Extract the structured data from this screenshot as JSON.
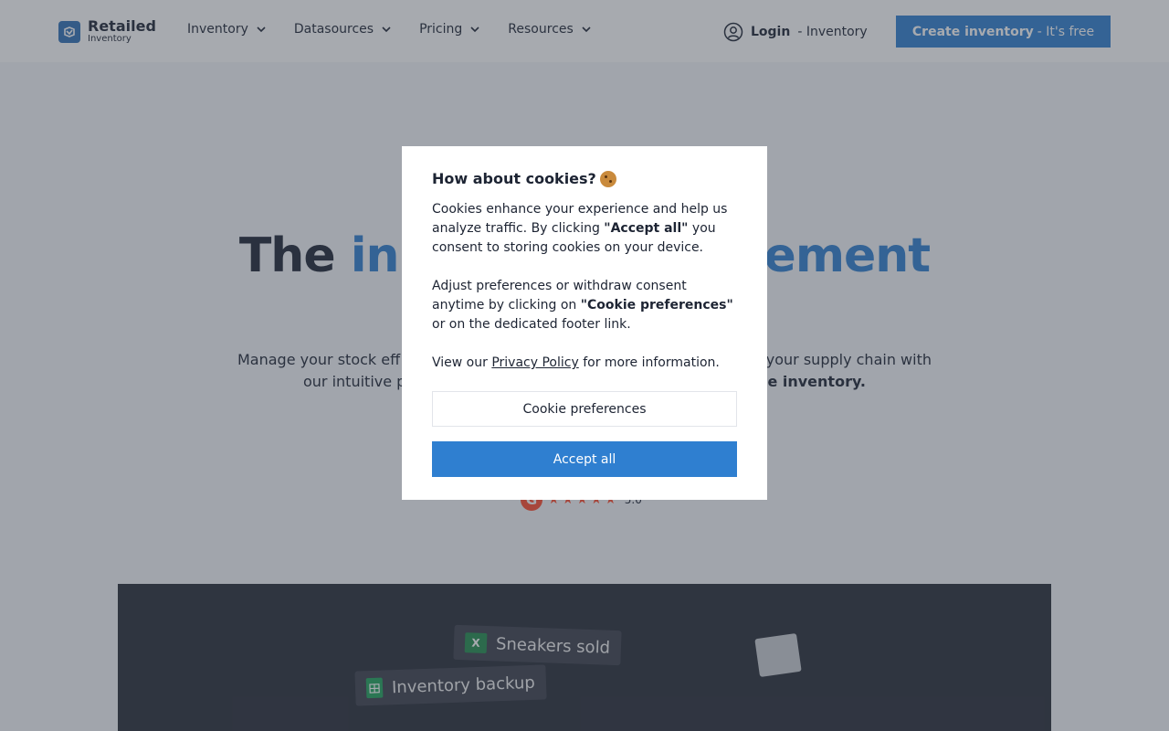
{
  "brand": {
    "name": "Retailed",
    "sub": "Inventory"
  },
  "nav": {
    "items": [
      {
        "label": "Inventory"
      },
      {
        "label": "Datasources"
      },
      {
        "label": "Pricing"
      },
      {
        "label": "Resources"
      }
    ],
    "login_bold": "Login",
    "login_rest": "- Inventory",
    "cta_bold": "Create inventory",
    "cta_rest": "- It's free"
  },
  "hero": {
    "title_start": "The",
    "title_accent_left": "in",
    "title_accent_right": "ement",
    "desc_left": "Manage your stock eff",
    "desc_right": "your supply chain with",
    "desc_left2": "our intuitive p",
    "desc_right2_bold": "he inventory.",
    "rating_value": "5.0"
  },
  "demo": {
    "chip_sneakers": "Sneakers sold",
    "chip_backup": "Inventory backup"
  },
  "cookie_modal": {
    "title": "How about cookies?",
    "p1_before": "Cookies enhance your experience and help us analyze traffic. By clicking ",
    "p1_bold": "\"Accept all\"",
    "p1_after": " you consent to storing cookies on your device.",
    "p2_before": "Adjust preferences or withdraw consent anytime by clicking on ",
    "p2_bold": "\"Cookie preferences\"",
    "p2_after": " or on the dedicated footer link.",
    "p3_before": "View our ",
    "p3_link": "Privacy Policy",
    "p3_after": " for more information.",
    "preferences_label": "Cookie preferences",
    "accept_label": "Accept all"
  },
  "colors": {
    "accent": "#2f7fd0",
    "brand": "#2f6fb6",
    "text": "#1d2433",
    "rating": "#ff492c"
  },
  "icons": [
    "retailed-logo-icon",
    "chevron-down-icon",
    "user-circle-icon",
    "g2-logo-icon",
    "star-icon",
    "cookie-icon",
    "excel-icon",
    "sheets-icon"
  ]
}
